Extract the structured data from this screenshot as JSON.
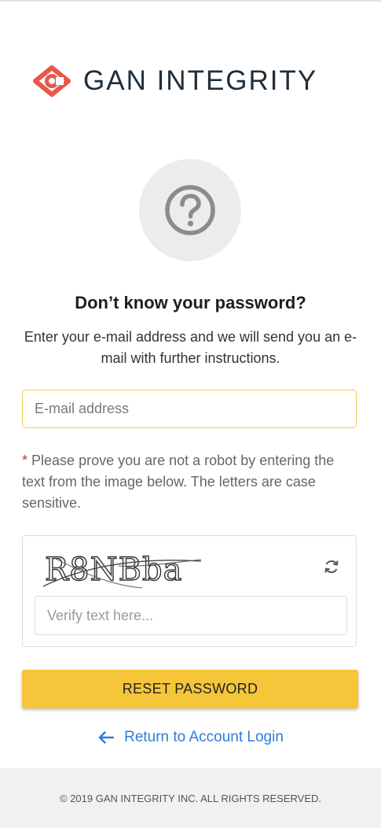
{
  "brand": {
    "name": "GAN INTEGRITY",
    "accent_color": "#e8574a",
    "text_color": "#1f2e3a"
  },
  "icons": {
    "logo": "gan-integrity-logo-icon",
    "help": "question-circle-icon",
    "refresh": "refresh-icon",
    "back": "arrow-left-icon"
  },
  "page": {
    "title": "Don’t know your password?",
    "subtitle": "Enter your e-mail address and we will send you an e-mail with further instructions."
  },
  "email_field": {
    "placeholder": "E-mail address",
    "value": "",
    "border_color": "#f0cf4a"
  },
  "captcha": {
    "required_marker": "*",
    "instructions": "Please prove you are not a robot by entering the text from the image below. The letters are case sensitive.",
    "image_text": "R8NBba",
    "verify_placeholder": "Verify text here...",
    "verify_value": ""
  },
  "actions": {
    "reset_label": "RESET PASSWORD",
    "reset_color": "#f5c53a",
    "return_label": "Return to Account Login",
    "link_color": "#2f7cd8"
  },
  "footer": {
    "copyright": "© 2019 GAN INTEGRITY INC. ALL RIGHTS RESERVED."
  }
}
